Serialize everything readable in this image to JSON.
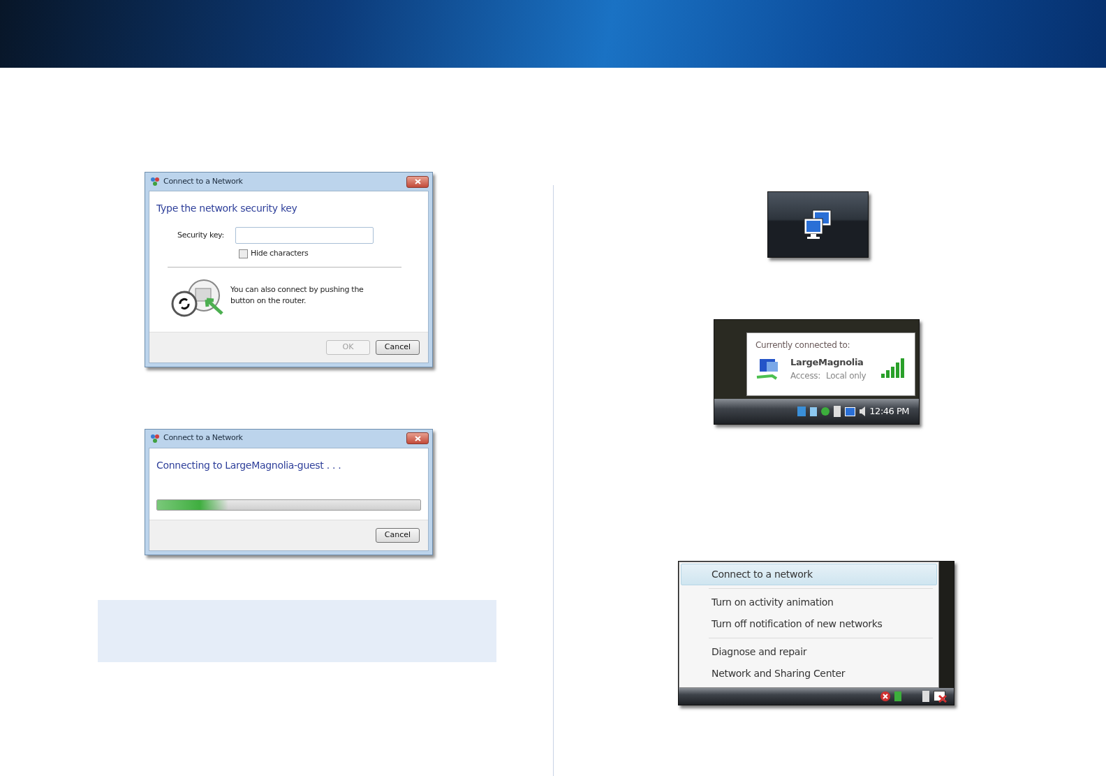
{
  "dialogs": [
    {
      "kind": "key",
      "title": "Connect to a Network",
      "heading": "Type the network security key",
      "field_label": "Security key:",
      "hide_characters": {
        "label": "Hide characters",
        "checked": false
      },
      "hint": "You can also connect by pushing the button on the router.",
      "buttons": [
        {
          "label": "OK",
          "disabled": true
        },
        {
          "label": "Cancel",
          "disabled": false
        }
      ]
    },
    {
      "kind": "progress",
      "title": "Connect to a Network",
      "heading": "Connecting to LargeMagnolia-guest . . .",
      "progress": {
        "level": 0.27
      },
      "buttons": [
        {
          "label": "Cancel",
          "disabled": false
        }
      ]
    }
  ],
  "notification": {
    "title": "Currently connected to:",
    "network": "LargeMagnolia",
    "access_label": "Access:",
    "access_value": "Local only",
    "clock": "12:46 PM"
  },
  "menu": {
    "groups": [
      [
        {
          "label": "Connect to a network",
          "selected": true
        }
      ],
      [
        {
          "label": "Turn on activity animation",
          "selected": false
        },
        {
          "label": "Turn off notification of new networks",
          "selected": false
        }
      ],
      [
        {
          "label": "Diagnose and repair",
          "selected": false
        },
        {
          "label": "Network and Sharing Center",
          "selected": false
        }
      ]
    ]
  }
}
